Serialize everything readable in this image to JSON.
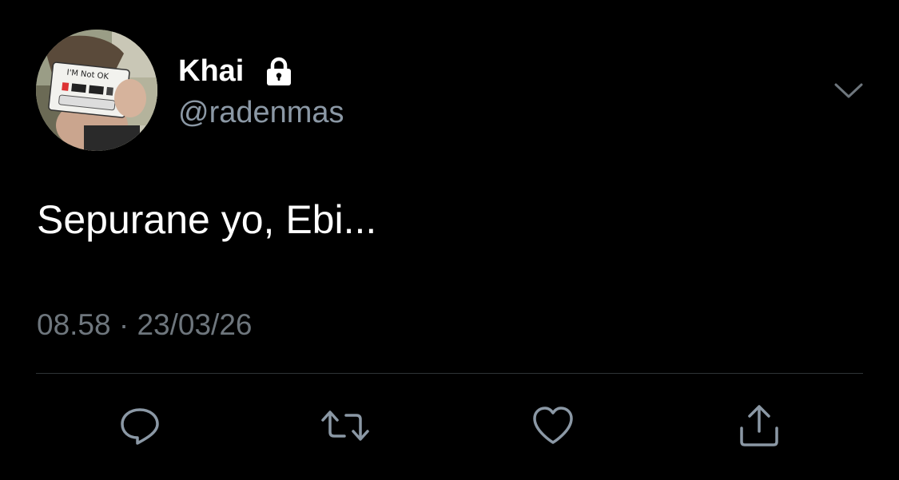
{
  "tweet": {
    "display_name": "Khai",
    "handle": "@radenmas",
    "text": "Sepurane yo, Ebi...",
    "timestamp": "08.58 · 23/03/26",
    "protected": true
  },
  "avatar": {
    "cassette_label": "I'M Not OK"
  },
  "icons": {
    "lock": "lock-icon",
    "menu": "chevron-down-icon",
    "reply": "reply-icon",
    "retweet": "retweet-icon",
    "like": "heart-icon",
    "share": "share-icon"
  },
  "colors": {
    "background": "#000000",
    "primary_text": "#ffffff",
    "secondary_text": "#8b98a5",
    "muted_text": "#6e767d",
    "icon": "#8b98a5",
    "divider": "#2f3336"
  }
}
